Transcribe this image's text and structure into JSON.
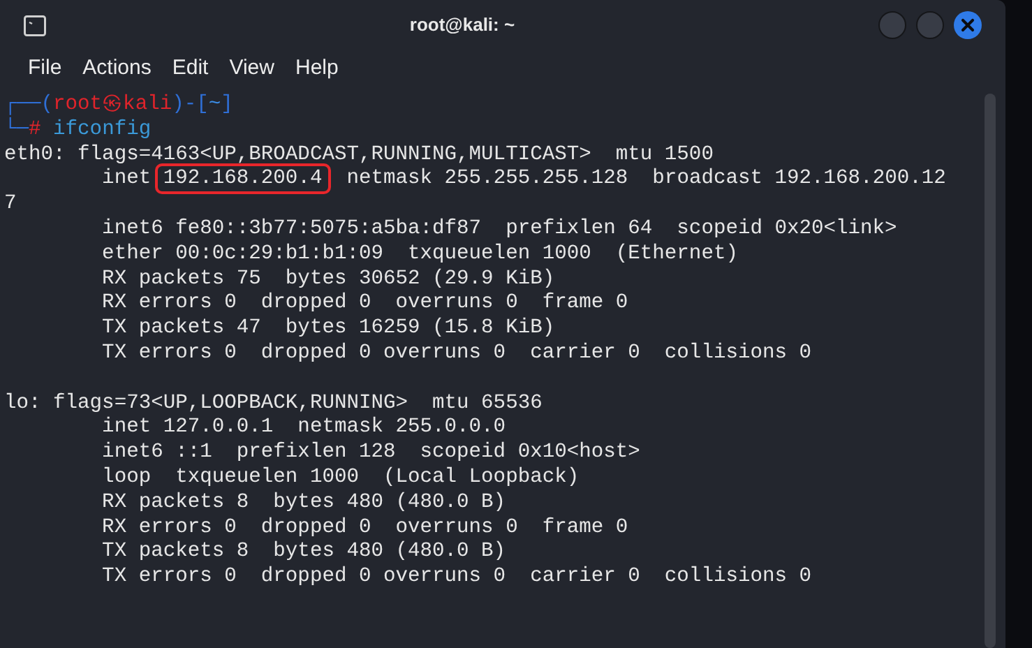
{
  "window": {
    "title": "root@kali: ~"
  },
  "menu": [
    "File",
    "Actions",
    "Edit",
    "View",
    "Help"
  ],
  "terminal": {
    "lines": [
      [
        {
          "text": "┌──(",
          "color": "#2f6fd6"
        },
        {
          "text": "root㉿kali",
          "color": "#e0242b"
        },
        {
          "text": ")-[",
          "color": "#2f6fd6"
        },
        {
          "text": "~",
          "color": "#3b8ee8"
        },
        {
          "text": "]",
          "color": "#2f6fd6"
        }
      ],
      [
        {
          "text": "└─",
          "color": "#2f6fd6"
        },
        {
          "text": "#",
          "color": "#e0242b"
        },
        {
          "text": " ifconfig",
          "color": "#3b9ad9"
        }
      ],
      [
        {
          "text": "eth0: flags=4163<UP,BROADCAST,RUNNING,MULTICAST>  mtu 1500",
          "color": "#e6e6e6"
        }
      ],
      [
        {
          "text": "        inet ",
          "color": "#e6e6e6"
        },
        {
          "text": "192.168.200.4",
          "color": "#e6e6e6",
          "boxed": true
        },
        {
          "text": "  netmask 255.255.255.128  broadcast 192.168.200.12",
          "color": "#e6e6e6"
        }
      ],
      [
        {
          "text": "7",
          "color": "#e6e6e6"
        }
      ],
      [
        {
          "text": "        inet6 fe80::3b77:5075:a5ba:df87  prefixlen 64  scopeid 0x20<link>",
          "color": "#e6e6e6"
        }
      ],
      [
        {
          "text": "        ether 00:0c:29:b1:b1:09  txqueuelen 1000  (Ethernet)",
          "color": "#e6e6e6"
        }
      ],
      [
        {
          "text": "        RX packets 75  bytes 30652 (29.9 KiB)",
          "color": "#e6e6e6"
        }
      ],
      [
        {
          "text": "        RX errors 0  dropped 0  overruns 0  frame 0",
          "color": "#e6e6e6"
        }
      ],
      [
        {
          "text": "        TX packets 47  bytes 16259 (15.8 KiB)",
          "color": "#e6e6e6"
        }
      ],
      [
        {
          "text": "        TX errors 0  dropped 0 overruns 0  carrier 0  collisions 0",
          "color": "#e6e6e6"
        }
      ],
      {
        "kind": "blank"
      },
      [
        {
          "text": "lo: flags=73<UP,LOOPBACK,RUNNING>  mtu 65536",
          "color": "#e6e6e6"
        }
      ],
      [
        {
          "text": "        inet 127.0.0.1  netmask 255.0.0.0",
          "color": "#e6e6e6"
        }
      ],
      [
        {
          "text": "        inet6 ::1  prefixlen 128  scopeid 0x10<host>",
          "color": "#e6e6e6"
        }
      ],
      [
        {
          "text": "        loop  txqueuelen 1000  (Local Loopback)",
          "color": "#e6e6e6"
        }
      ],
      [
        {
          "text": "        RX packets 8  bytes 480 (480.0 B)",
          "color": "#e6e6e6"
        }
      ],
      [
        {
          "text": "        RX errors 0  dropped 0  overruns 0  frame 0",
          "color": "#e6e6e6"
        }
      ],
      [
        {
          "text": "        TX packets 8  bytes 480 (480.0 B)",
          "color": "#e6e6e6"
        }
      ],
      [
        {
          "text": "        TX errors 0  dropped 0 overruns 0  carrier 0  collisions 0",
          "color": "#e6e6e6"
        }
      ]
    ]
  }
}
